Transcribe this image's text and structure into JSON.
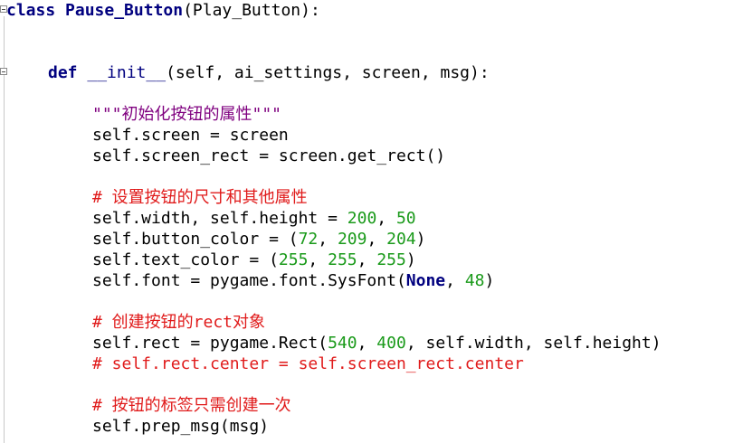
{
  "editor": {
    "lines": [
      {
        "parts": [
          {
            "t": "class",
            "c": "kw"
          },
          {
            "t": " "
          },
          {
            "t": "Pause_Button",
            "c": "cls"
          },
          {
            "t": "(Play_Button):"
          }
        ]
      },
      {
        "parts": [
          {
            "t": "def",
            "c": "kw"
          },
          {
            "t": " "
          },
          {
            "t": "__init__",
            "c": "fn"
          },
          {
            "t": "(self, ai_settings, screen, msg):"
          }
        ]
      },
      {
        "parts": [
          {
            "t": "\"\"\"初始化按钮的属性\"\"\"",
            "c": "str"
          }
        ]
      },
      {
        "parts": [
          {
            "t": "self.screen = screen"
          }
        ]
      },
      {
        "parts": [
          {
            "t": "self.screen_rect = screen.get_rect()"
          }
        ]
      },
      {
        "parts": [
          {
            "t": "# 设置按钮的尺寸和其他属性",
            "c": "cmt"
          }
        ]
      },
      {
        "parts": [
          {
            "t": "self.width, self.height = "
          },
          {
            "t": "200",
            "c": "num"
          },
          {
            "t": ", "
          },
          {
            "t": "50",
            "c": "num"
          }
        ]
      },
      {
        "parts": [
          {
            "t": "self.button_color = ("
          },
          {
            "t": "72",
            "c": "num"
          },
          {
            "t": ", "
          },
          {
            "t": "209",
            "c": "num"
          },
          {
            "t": ", "
          },
          {
            "t": "204",
            "c": "num"
          },
          {
            "t": ")"
          }
        ]
      },
      {
        "parts": [
          {
            "t": "self.text_color = ("
          },
          {
            "t": "255",
            "c": "num"
          },
          {
            "t": ", "
          },
          {
            "t": "255",
            "c": "num"
          },
          {
            "t": ", "
          },
          {
            "t": "255",
            "c": "num"
          },
          {
            "t": ")"
          }
        ]
      },
      {
        "parts": [
          {
            "t": "self.font = pygame.font.SysFont("
          },
          {
            "t": "None",
            "c": "const"
          },
          {
            "t": ", "
          },
          {
            "t": "48",
            "c": "num"
          },
          {
            "t": ")"
          }
        ]
      },
      {
        "parts": [
          {
            "t": "# 创建按钮的rect对象",
            "c": "cmt"
          }
        ]
      },
      {
        "parts": [
          {
            "t": "self.rect = pygame.Rect("
          },
          {
            "t": "540",
            "c": "num"
          },
          {
            "t": ", "
          },
          {
            "t": "400",
            "c": "num"
          },
          {
            "t": ", self.width, self.height)"
          }
        ]
      },
      {
        "parts": [
          {
            "t": "# self.rect.center = self.screen_rect.center",
            "c": "cmt"
          }
        ]
      },
      {
        "parts": [
          {
            "t": "# 按钮的标签只需创建一次",
            "c": "cmt"
          }
        ]
      },
      {
        "parts": [
          {
            "t": "self.prep_msg(msg)"
          }
        ]
      }
    ]
  },
  "colors": {
    "keyword": "#00007f",
    "number": "#1a9a1a",
    "string": "#7f007f",
    "comment": "#e01a1a",
    "background": "#ffffff"
  }
}
